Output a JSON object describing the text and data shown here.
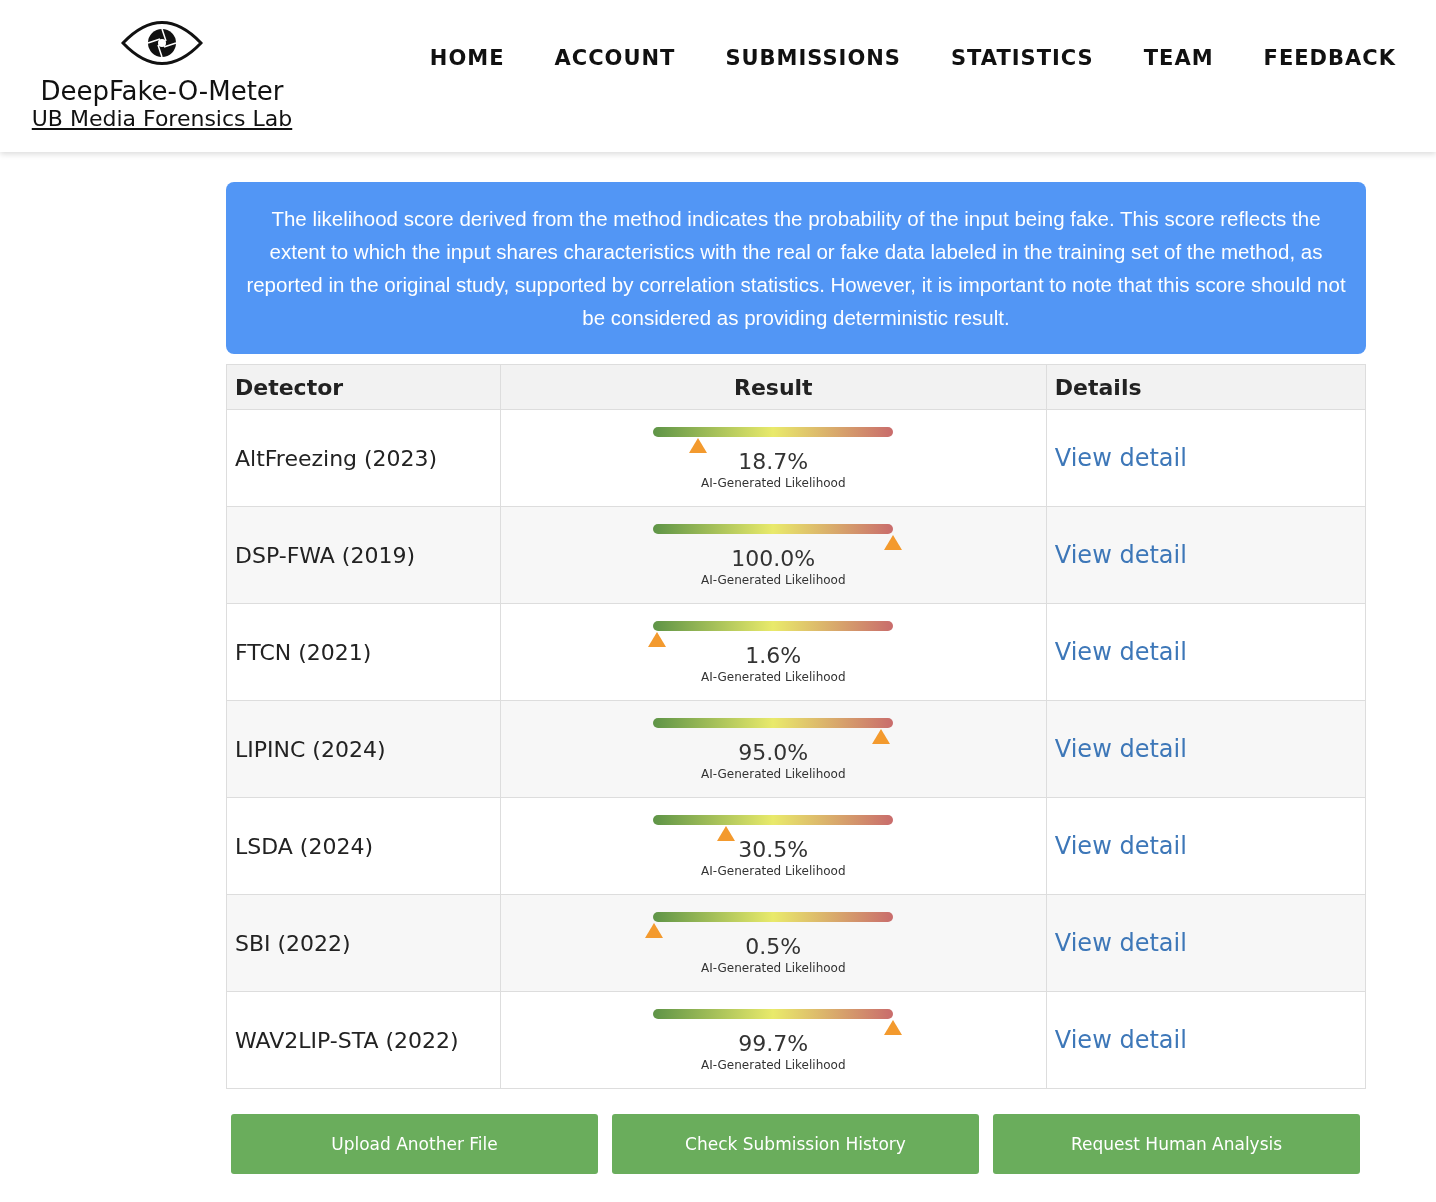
{
  "header": {
    "site_title": "DeepFake-O-Meter",
    "lab_link": "UB Media Forensics Lab",
    "nav": [
      "HOME",
      "ACCOUNT",
      "SUBMISSIONS",
      "STATISTICS",
      "TEAM",
      "FEEDBACK"
    ]
  },
  "notice": "The likelihood score derived from the method indicates the probability of the input being fake. This score reflects the extent to which the input shares characteristics with the real or fake data labeled in the training set of the method, as reported in the original study, supported by correlation statistics. However, it is important to note that this score should not be considered as providing deterministic result.",
  "table": {
    "columns": [
      "Detector",
      "Result",
      "Details"
    ],
    "rows": [
      {
        "detector": "AltFreezing (2023)",
        "level": 0.187,
        "score": "18.7%",
        "caption": "AI-Generated Likelihood",
        "link": "View detail"
      },
      {
        "detector": "DSP-FWA (2019)",
        "level": 1.0,
        "score": "100.0%",
        "caption": "AI-Generated Likelihood",
        "link": "View detail"
      },
      {
        "detector": "FTCN (2021)",
        "level": 0.016,
        "score": "1.6%",
        "caption": "AI-Generated Likelihood",
        "link": "View detail"
      },
      {
        "detector": "LIPINC (2024)",
        "level": 0.95,
        "score": "95.0%",
        "caption": "AI-Generated Likelihood",
        "link": "View detail"
      },
      {
        "detector": "LSDA (2024)",
        "level": 0.305,
        "score": "30.5%",
        "caption": "AI-Generated Likelihood",
        "link": "View detail"
      },
      {
        "detector": "SBI (2022)",
        "level": 0.005,
        "score": "0.5%",
        "caption": "AI-Generated Likelihood",
        "link": "View detail"
      },
      {
        "detector": "WAV2LIP-STA (2022)",
        "level": 0.997,
        "score": "99.7%",
        "caption": "AI-Generated Likelihood",
        "link": "View detail"
      }
    ]
  },
  "buttons": [
    "Upload Another File",
    "Check Submission History",
    "Request Human Analysis"
  ]
}
